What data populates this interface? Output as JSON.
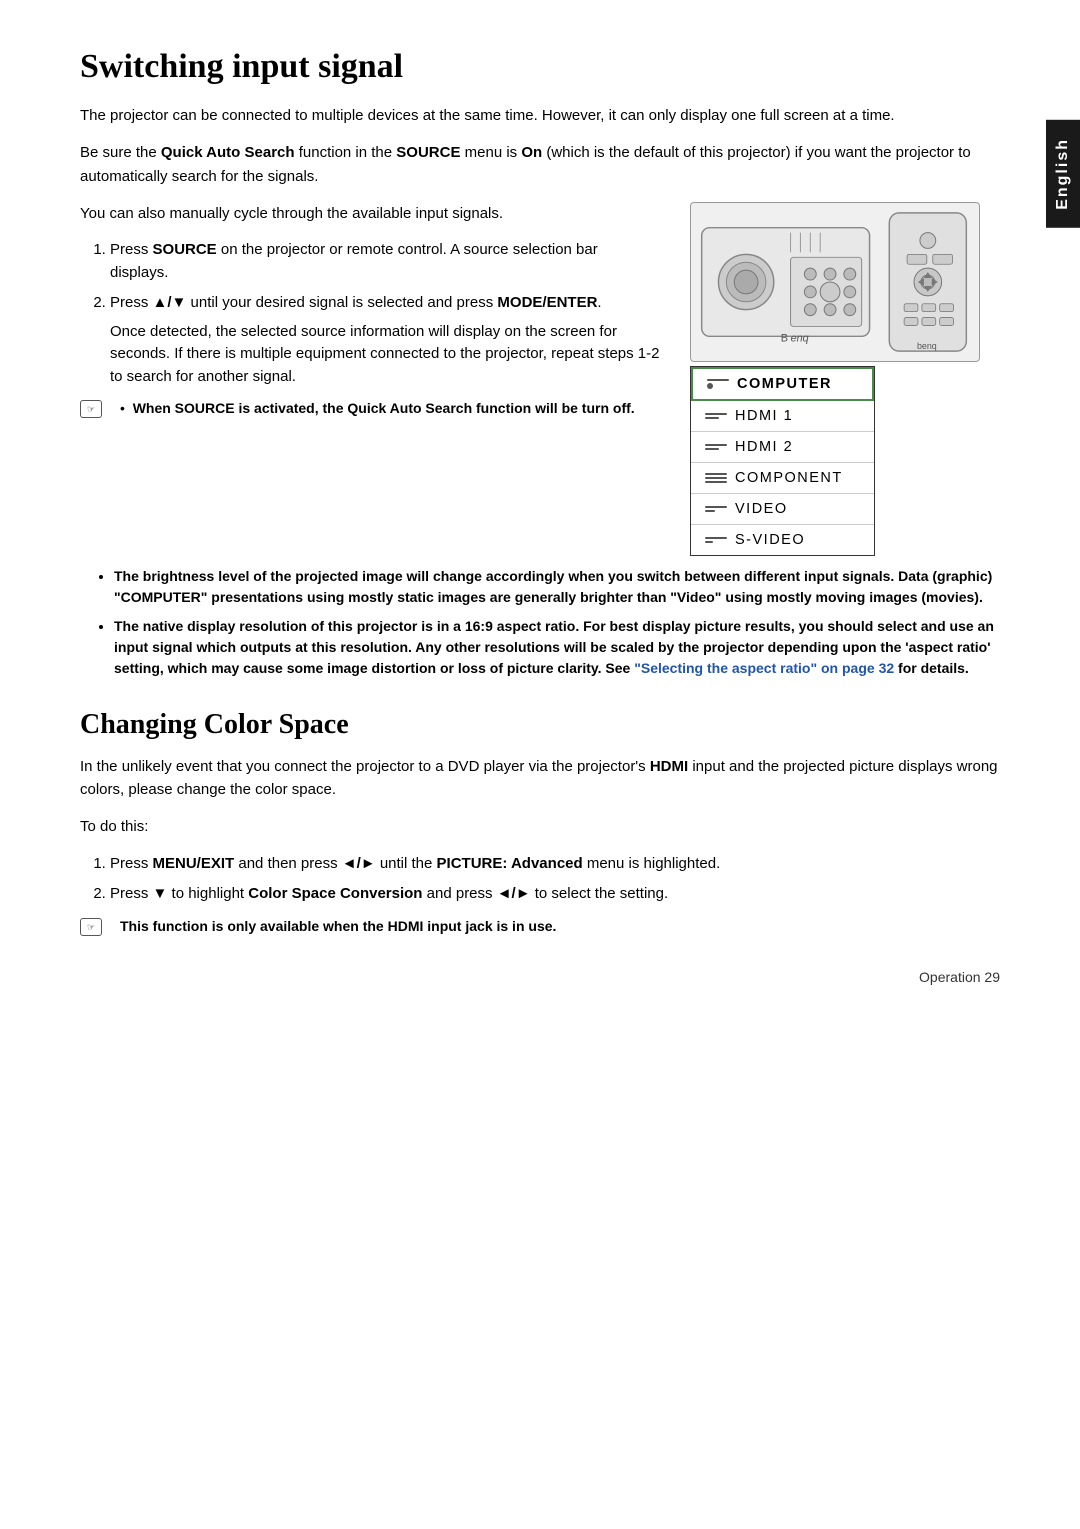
{
  "page": {
    "title": "Switching input signal",
    "title2": "Changing Color Space",
    "english_tab": "English",
    "footer": "Operation    29"
  },
  "switching": {
    "intro1": "The projector can be connected to multiple devices at the same time. However, it can only display one full screen at a time.",
    "intro2_part1": "Be sure the ",
    "intro2_bold1": "Quick Auto Search",
    "intro2_part2": " function in the ",
    "intro2_bold2": "SOURCE",
    "intro2_part3": " menu is ",
    "intro2_bold3": "On",
    "intro2_part4": " (which is the default of this projector) if you want the projector to automatically search for the signals.",
    "intro3": "You can also manually cycle through the available input signals.",
    "step1_part1": "Press ",
    "step1_bold": "SOURCE",
    "step1_part2": " on the projector or remote control. A source selection bar displays.",
    "step2_part1": "Press ",
    "step2_sym": "▲/▼",
    "step2_part2": " until your desired signal is selected and press ",
    "step2_bold": "MODE/ENTER",
    "step2_part3": ".",
    "step2_cont": "Once detected, the selected source information will display on the screen for seconds. If there is multiple equipment connected to the projector, repeat steps 1-2 to search for another signal.",
    "note1_bold": "When SOURCE is activated, the Quick Auto Search function will be turn off.",
    "bullets": [
      "The brightness level of the projected image will change accordingly when you switch between different input signals. Data (graphic) \"COMPUTER\" presentations using mostly static images are generally brighter than \"Video\" using mostly moving images (movies).",
      "The native display resolution of this projector is in a 16:9 aspect ratio. For best display picture results, you should select and use an input signal which outputs at this resolution. Any other resolutions will be scaled by the projector depending upon the 'aspect ratio' setting, which may cause some image distortion or loss of picture clarity. See "
    ],
    "bullet2_link": "\"Selecting the aspect ratio\" on page 32",
    "bullet2_end": " for details."
  },
  "source_menu": {
    "items": [
      {
        "label": "COMPUTER",
        "selected": true
      },
      {
        "label": "HDMI 1",
        "selected": false
      },
      {
        "label": "HDMI 2",
        "selected": false
      },
      {
        "label": "COMPONENT",
        "selected": false
      },
      {
        "label": "VIDEO",
        "selected": false
      },
      {
        "label": "S-VIDEO",
        "selected": false
      }
    ]
  },
  "changing": {
    "intro1_part1": "In the unlikely event that you connect the projector to a DVD player via the projector's ",
    "intro1_bold1": "HDMI",
    "intro1_part2": " input and the projected picture displays wrong colors, please change the color space.",
    "intro2": "To do this:",
    "step1_part1": "Press ",
    "step1_bold1": "MENU/EXIT",
    "step1_part2": " and then press ",
    "step1_sym": "◄/►",
    "step1_part3": " until the ",
    "step1_bold2": "PICTURE: Advanced",
    "step1_part4": " menu is highlighted.",
    "step2_part1": "Press ",
    "step2_sym": "▼",
    "step2_part2": " to highlight ",
    "step2_bold1": "Color Space Conversion",
    "step2_part3": " and press ",
    "step2_sym2": "◄/►",
    "step2_part4": " to select the setting.",
    "note_bold": "This function is only available when the HDMI input jack is in use."
  }
}
